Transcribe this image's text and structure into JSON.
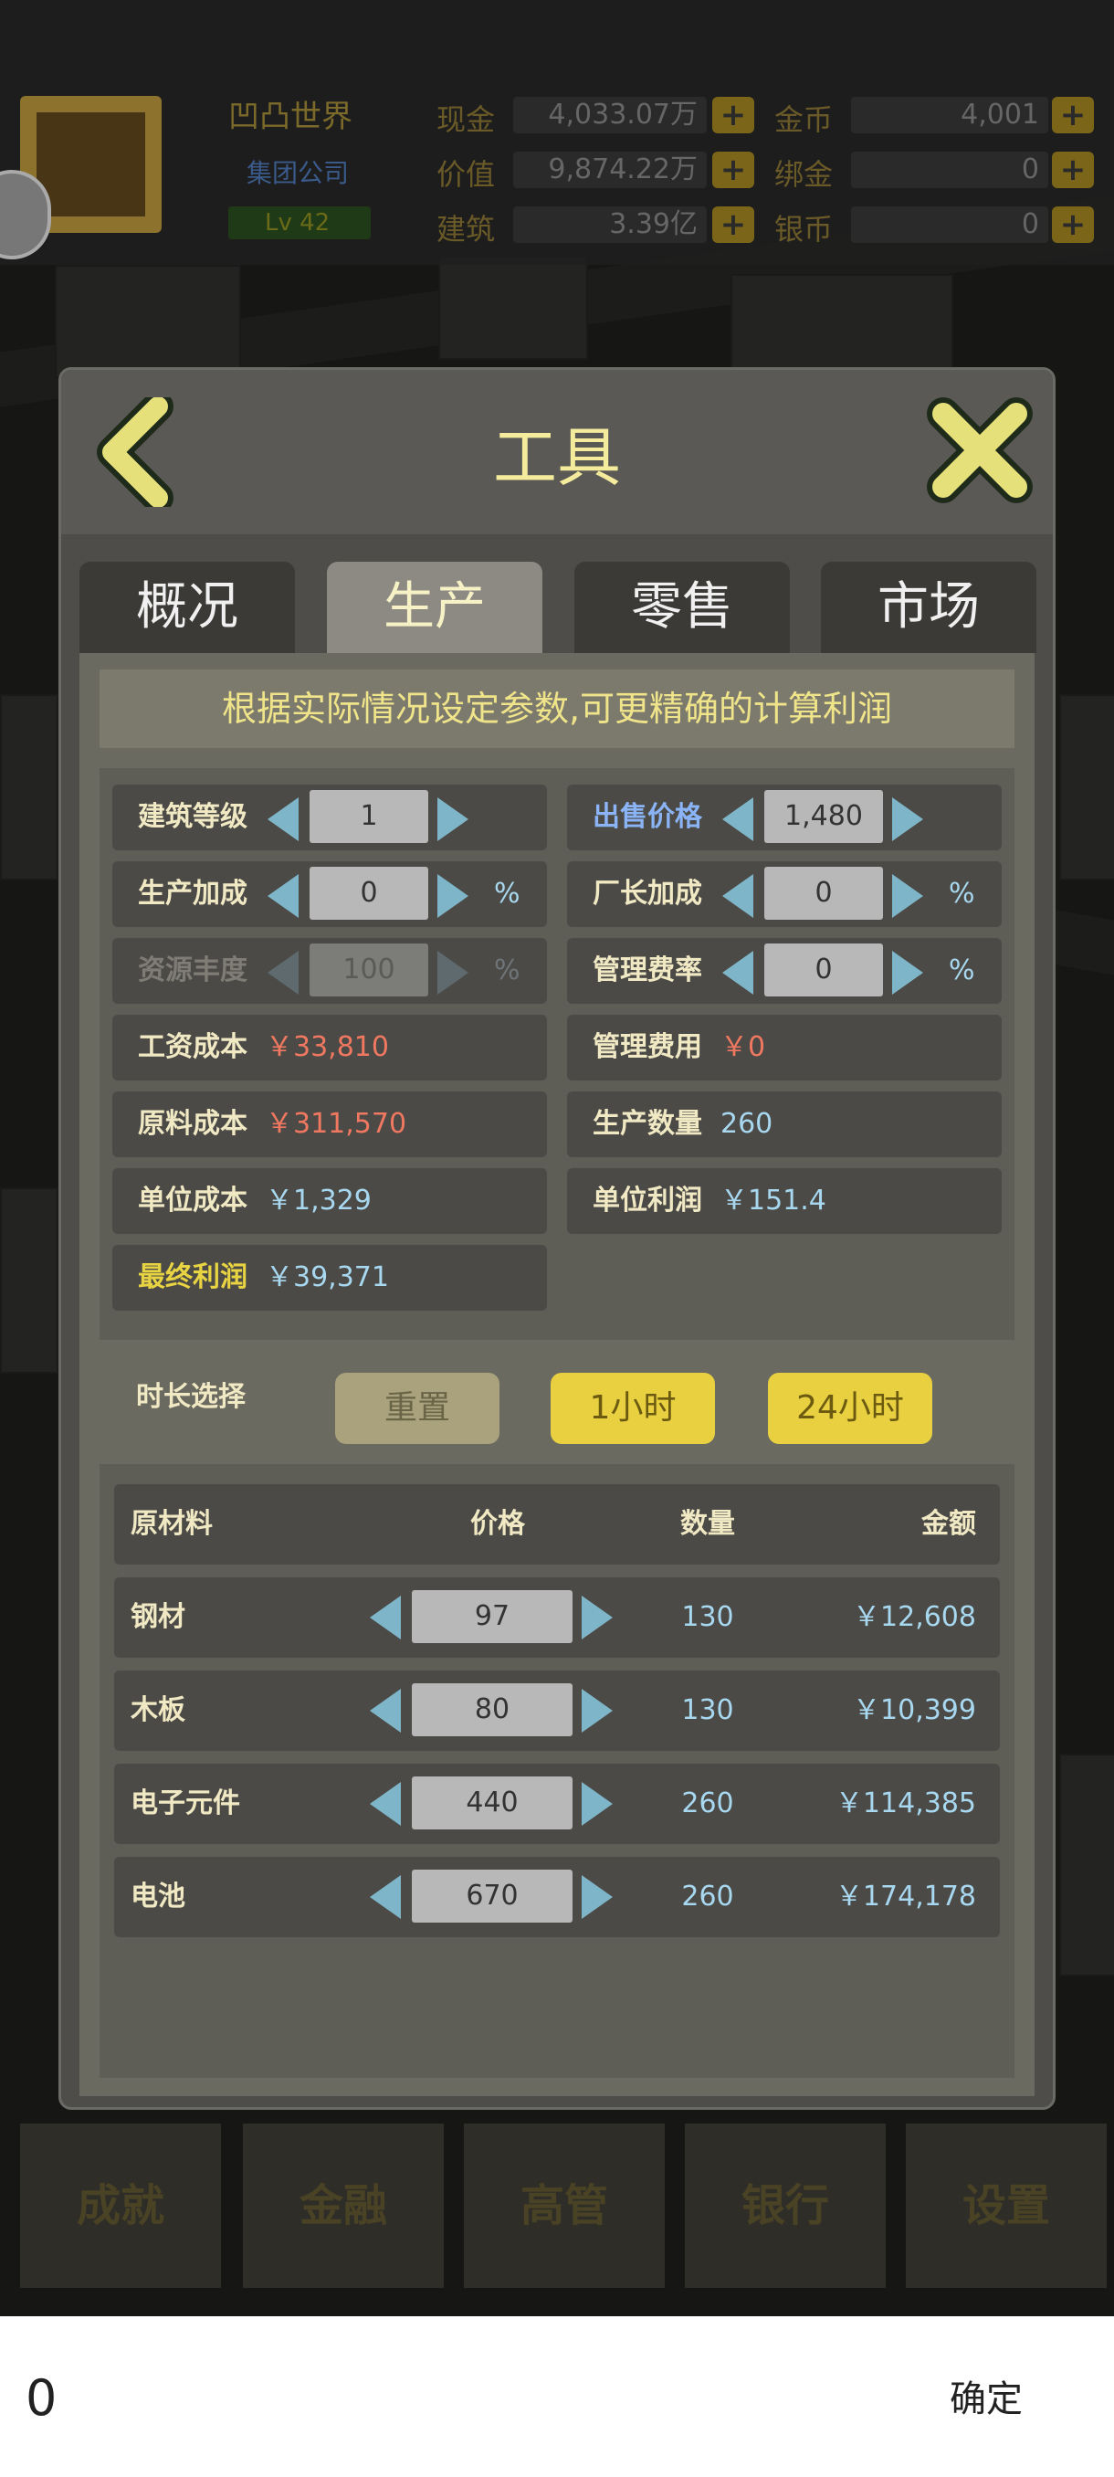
{
  "hud": {
    "company_name": "凹凸世界",
    "company_type": "集团公司",
    "level": "Lv 42",
    "stats": [
      {
        "label": "现金",
        "value": "4,033.07万"
      },
      {
        "label": "价值",
        "value": "9,874.22万"
      },
      {
        "label": "建筑",
        "value": "3.39亿"
      }
    ],
    "currencies": [
      {
        "label": "金币",
        "value": "4,001"
      },
      {
        "label": "绑金",
        "value": "0"
      },
      {
        "label": "银币",
        "value": "0"
      }
    ],
    "plus_icon": "plus-icon"
  },
  "modal": {
    "title": "工具",
    "back_icon": "chevron-left-icon",
    "close_icon": "close-icon",
    "tabs": [
      {
        "label": "概况",
        "active": false
      },
      {
        "label": "生产",
        "active": true
      },
      {
        "label": "零售",
        "active": false
      },
      {
        "label": "市场",
        "active": false
      }
    ],
    "hint": "根据实际情况设定参数,可更精确的计算利润",
    "params": {
      "building_level": {
        "label": "建筑等级",
        "value": "1"
      },
      "sale_price": {
        "label": "出售价格",
        "value": "1,480"
      },
      "production_bonus": {
        "label": "生产加成",
        "value": "0",
        "unit": "%"
      },
      "manager_bonus": {
        "label": "厂长加成",
        "value": "0",
        "unit": "%"
      },
      "resource_abundance": {
        "label": "资源丰度",
        "value": "100",
        "unit": "%",
        "disabled": true
      },
      "management_rate": {
        "label": "管理费率",
        "value": "0",
        "unit": "%"
      },
      "wage_cost": {
        "label": "工资成本",
        "value": "￥33,810"
      },
      "management_fee": {
        "label": "管理费用",
        "value": "￥0"
      },
      "material_cost": {
        "label": "原料成本",
        "value": "￥311,570"
      },
      "production_qty": {
        "label": "生产数量",
        "value": "260"
      },
      "unit_cost": {
        "label": "单位成本",
        "value": "￥1,329"
      },
      "unit_profit": {
        "label": "单位利润",
        "value": "￥151.4"
      },
      "final_profit": {
        "label": "最终利润",
        "value": "￥39,371"
      }
    },
    "duration": {
      "label": "时长选择",
      "reset": "重置",
      "one_hour": "1小时",
      "day": "24小时"
    },
    "materials": {
      "headers": {
        "name": "原材料",
        "price": "价格",
        "qty": "数量",
        "amount": "金额"
      },
      "rows": [
        {
          "name": "钢材",
          "price": "97",
          "qty": "130",
          "amount": "￥12,608"
        },
        {
          "name": "木板",
          "price": "80",
          "qty": "130",
          "amount": "￥10,399"
        },
        {
          "name": "电子元件",
          "price": "440",
          "qty": "260",
          "amount": "￥114,385"
        },
        {
          "name": "电池",
          "price": "670",
          "qty": "260",
          "amount": "￥174,178"
        }
      ]
    }
  },
  "bottom_menu": [
    "成就",
    "金融",
    "高管",
    "银行",
    "设置"
  ],
  "input_bar": {
    "value": "0",
    "confirm": "确定"
  },
  "colors": {
    "accent_yellow": "#e8d040",
    "title_yellow": "#f4ec9c",
    "value_blue": "#a8d8f0",
    "cost_red": "#f07860",
    "arrow_teal": "#7fb5c8"
  }
}
